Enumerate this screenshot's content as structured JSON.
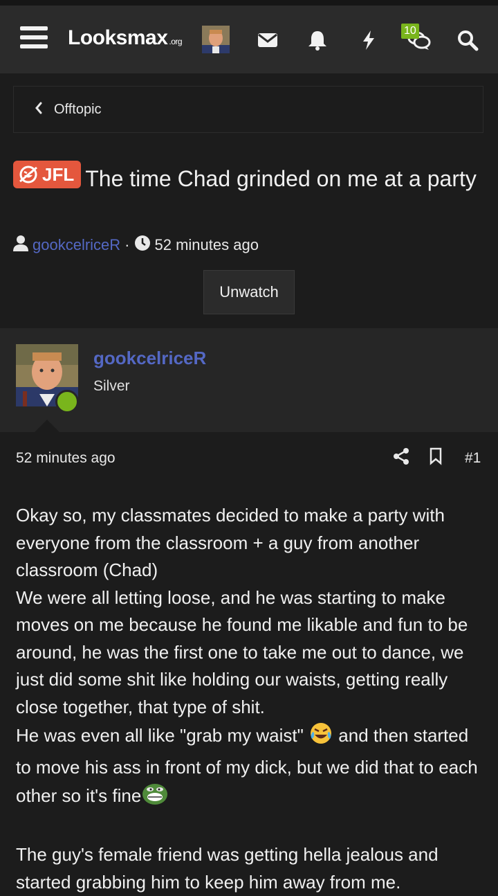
{
  "header": {
    "logo_main": "Looksmax",
    "logo_suffix": ".org",
    "badge_count": "10"
  },
  "breadcrumb": {
    "label": "Offtopic"
  },
  "thread": {
    "prefix": "JFL",
    "title": "The time Chad grinded on me at a party",
    "author": "gookcelriceR",
    "separator": "·",
    "time": "52 minutes ago",
    "unwatch_label": "Unwatch"
  },
  "post": {
    "username": "gookcelriceR",
    "user_title": "Silver",
    "time": "52 minutes ago",
    "number": "#1",
    "lines": {
      "l1": "Okay so, my classmates decided to make a party with everyone from the classroom + a guy from another classroom (Chad)",
      "l2": "We were all letting loose, and he was starting to make moves on me because he found me likable and fun to be around, he was the first one to take me out to dance, we just did some shit like holding our waists, getting really close together, that type of shit.",
      "l3a": "He was even all like \"grab my waist\" ",
      "l3b": " and then started to move his ass in front of my dick, but we did that to each other so it's fine",
      "l4": "The guy's female friend was getting hella jealous and started grabbing him to keep him away from me."
    }
  },
  "colors": {
    "accent_link": "#5468c4",
    "prefix_bg": "#e4573d",
    "online": "#79b51c",
    "background": "#1c1c1c",
    "navbar": "#2b2b2b"
  },
  "icons": [
    "menu-icon",
    "envelope-icon",
    "bell-icon",
    "bolt-icon",
    "chat-icon",
    "search-icon",
    "chevron-left-icon",
    "user-icon",
    "clock-icon",
    "share-icon",
    "bookmark-icon",
    "laughing-crying-emoji",
    "pepe-grin-emoji"
  ]
}
